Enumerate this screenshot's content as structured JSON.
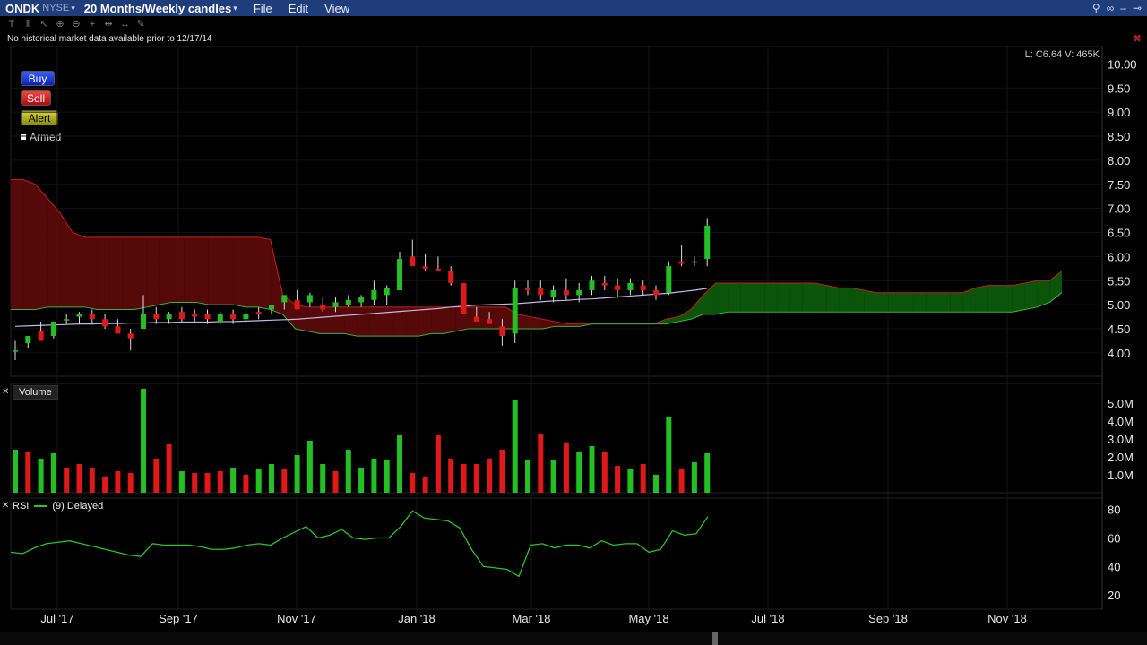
{
  "header": {
    "symbol": "ONDK",
    "exchange": "NYSE",
    "period": "20 Months/Weekly candles",
    "menu": [
      "File",
      "Edit",
      "View"
    ]
  },
  "notice": "No historical market data available prior to 12/17/14",
  "buttons": {
    "buy": "Buy",
    "sell": "Sell",
    "alert": "Alert",
    "armed": "Armed"
  },
  "last_info": "L: C6.64 V: 465K",
  "volume_label": "Volume",
  "rsi_label": {
    "name": "RSI",
    "params": "(9) Delayed"
  },
  "colors": {
    "up": "#22c022",
    "down": "#e01818",
    "cloud_red": "#5a0a0a",
    "cloud_green": "#0c5a0c",
    "titlebar": "#1f3d7a"
  },
  "chart_data": [
    {
      "type": "candlestick",
      "title": "ONDK",
      "ylim": [
        3.7,
        10.1
      ],
      "y_ticks": [
        "10.00",
        "9.50",
        "9.00",
        "8.50",
        "8.00",
        "7.50",
        "7.00",
        "6.50",
        "6.00",
        "5.50",
        "5.00",
        "4.50",
        "4.00"
      ],
      "x_ticks": [
        "Jul '17",
        "Sep '17",
        "Nov '17",
        "Jan '18",
        "Mar '18",
        "May '18",
        "Jul '18",
        "Sep '18",
        "Nov '18"
      ],
      "candles": [
        [
          4.05,
          4.25,
          3.85,
          4.05
        ],
        [
          4.2,
          4.35,
          4.1,
          4.35
        ],
        [
          4.45,
          4.65,
          4.25,
          4.25
        ],
        [
          4.35,
          4.65,
          4.3,
          4.65
        ],
        [
          4.7,
          4.8,
          4.6,
          4.7
        ],
        [
          4.75,
          4.85,
          4.6,
          4.8
        ],
        [
          4.8,
          4.9,
          4.6,
          4.7
        ],
        [
          4.7,
          4.8,
          4.5,
          4.55
        ],
        [
          4.55,
          4.7,
          4.4,
          4.4
        ],
        [
          4.4,
          4.5,
          4.05,
          4.3
        ],
        [
          4.5,
          5.2,
          4.5,
          4.8
        ],
        [
          4.8,
          4.95,
          4.6,
          4.7
        ],
        [
          4.7,
          4.85,
          4.6,
          4.8
        ],
        [
          4.85,
          4.95,
          4.65,
          4.7
        ],
        [
          4.8,
          4.9,
          4.65,
          4.75
        ],
        [
          4.8,
          4.9,
          4.6,
          4.7
        ],
        [
          4.65,
          4.85,
          4.6,
          4.8
        ],
        [
          4.8,
          4.9,
          4.6,
          4.7
        ],
        [
          4.7,
          4.9,
          4.6,
          4.8
        ],
        [
          4.85,
          4.95,
          4.7,
          4.8
        ],
        [
          4.9,
          5.0,
          4.8,
          5.0
        ],
        [
          5.05,
          5.2,
          4.9,
          5.2
        ],
        [
          5.1,
          5.3,
          4.9,
          4.9
        ],
        [
          5.05,
          5.25,
          4.95,
          5.2
        ],
        [
          5.0,
          5.15,
          4.85,
          4.9
        ],
        [
          4.95,
          5.15,
          4.85,
          5.05
        ],
        [
          5.0,
          5.2,
          4.95,
          5.1
        ],
        [
          5.05,
          5.2,
          4.95,
          5.15
        ],
        [
          5.1,
          5.5,
          5.0,
          5.3
        ],
        [
          5.2,
          5.4,
          5.0,
          5.35
        ],
        [
          5.3,
          6.1,
          5.3,
          5.95
        ],
        [
          6.0,
          6.35,
          5.8,
          5.8
        ],
        [
          5.8,
          6.05,
          5.7,
          5.75
        ],
        [
          5.75,
          6.0,
          5.7,
          5.7
        ],
        [
          5.7,
          5.8,
          5.4,
          5.45
        ],
        [
          5.45,
          5.45,
          4.8,
          4.8
        ],
        [
          4.75,
          4.95,
          4.65,
          4.65
        ],
        [
          4.7,
          4.85,
          4.6,
          4.6
        ],
        [
          4.55,
          4.7,
          4.15,
          4.35
        ],
        [
          4.4,
          5.5,
          4.2,
          5.35
        ],
        [
          5.35,
          5.5,
          5.2,
          5.3
        ],
        [
          5.35,
          5.5,
          5.1,
          5.2
        ],
        [
          5.15,
          5.4,
          5.05,
          5.3
        ],
        [
          5.3,
          5.55,
          5.1,
          5.2
        ],
        [
          5.2,
          5.45,
          5.05,
          5.3
        ],
        [
          5.3,
          5.6,
          5.2,
          5.5
        ],
        [
          5.45,
          5.6,
          5.3,
          5.4
        ],
        [
          5.4,
          5.55,
          5.15,
          5.3
        ],
        [
          5.3,
          5.55,
          5.2,
          5.45
        ],
        [
          5.4,
          5.5,
          5.2,
          5.3
        ],
        [
          5.3,
          5.4,
          5.1,
          5.2
        ],
        [
          5.25,
          5.9,
          5.2,
          5.8
        ],
        [
          5.9,
          6.25,
          5.8,
          5.85
        ],
        [
          5.9,
          6.0,
          5.8,
          5.9
        ],
        [
          5.95,
          6.8,
          5.8,
          6.64
        ]
      ],
      "overlay_line": {
        "name": "moving-average",
        "values": [
          4.55,
          4.56,
          4.57,
          4.58,
          4.59,
          4.6,
          4.6,
          4.61,
          4.61,
          4.62,
          4.62,
          4.63,
          4.63,
          4.64,
          4.64,
          4.64,
          4.65,
          4.65,
          4.66,
          4.67,
          4.68,
          4.69,
          4.7,
          4.72,
          4.74,
          4.76,
          4.78,
          4.8,
          4.82,
          4.84,
          4.86,
          4.88,
          4.9,
          4.92,
          4.95,
          4.97,
          4.99,
          5.0,
          5.01,
          5.02,
          5.04,
          5.06,
          5.08,
          5.09,
          5.11,
          5.12,
          5.14,
          5.16,
          5.18,
          5.2,
          5.22,
          5.24,
          5.27,
          5.3,
          5.34
        ]
      },
      "cloud": {
        "upper": [
          7.6,
          7.6,
          7.5,
          7.2,
          6.9,
          6.5,
          6.4,
          6.4,
          6.4,
          6.4,
          6.4,
          6.4,
          6.4,
          6.4,
          6.4,
          6.4,
          6.4,
          6.4,
          6.4,
          6.4,
          6.4,
          6.35,
          5.2,
          5.0,
          4.95,
          4.95,
          4.95,
          4.95,
          4.95,
          4.95,
          4.95,
          4.95,
          4.95,
          4.95,
          4.95,
          4.95,
          4.95,
          4.95,
          4.95,
          4.95,
          4.95,
          4.8,
          4.75,
          4.7,
          4.65,
          4.6,
          4.6,
          4.6,
          4.6,
          4.6,
          4.6,
          4.6,
          4.6,
          4.7,
          4.75,
          4.9,
          5.2,
          5.45,
          5.45,
          5.45,
          5.45,
          5.45,
          5.45,
          5.45,
          5.45,
          5.45,
          5.4,
          5.35,
          5.35,
          5.3,
          5.25,
          5.25,
          5.25,
          5.25,
          5.25,
          5.25,
          5.25,
          5.25,
          5.35,
          5.4,
          5.4,
          5.4,
          5.45,
          5.5,
          5.5,
          5.7
        ],
        "lower": [
          4.9,
          4.9,
          4.9,
          4.95,
          4.95,
          4.95,
          4.95,
          4.9,
          4.9,
          4.9,
          4.9,
          4.95,
          5.0,
          5.05,
          5.05,
          5.05,
          5.0,
          5.0,
          5.0,
          4.95,
          4.95,
          4.9,
          4.8,
          4.5,
          4.45,
          4.4,
          4.4,
          4.4,
          4.35,
          4.35,
          4.35,
          4.35,
          4.35,
          4.35,
          4.4,
          4.4,
          4.45,
          4.5,
          4.5,
          4.5,
          4.5,
          4.5,
          4.5,
          4.5,
          4.55,
          4.55,
          4.55,
          4.6,
          4.6,
          4.6,
          4.6,
          4.6,
          4.6,
          4.6,
          4.65,
          4.7,
          4.8,
          4.8,
          4.85,
          4.85,
          4.85,
          4.85,
          4.85,
          4.85,
          4.85,
          4.85,
          4.85,
          4.85,
          4.85,
          4.85,
          4.85,
          4.85,
          4.85,
          4.85,
          4.85,
          4.85,
          4.85,
          4.85,
          4.85,
          4.85,
          4.85,
          4.85,
          4.9,
          4.95,
          5.05,
          5.25
        ]
      }
    },
    {
      "type": "bar",
      "title": "Volume",
      "ylim": [
        0,
        5800000
      ],
      "y_ticks": [
        "5.0M",
        "4.0M",
        "3.0M",
        "2.0M",
        "1.0M"
      ],
      "values": [
        2.4,
        2.3,
        1.9,
        2.2,
        1.4,
        1.6,
        1.4,
        0.9,
        1.2,
        1.1,
        5.8,
        1.9,
        2.7,
        1.2,
        1.1,
        1.1,
        1.2,
        1.4,
        1.0,
        1.3,
        1.6,
        1.3,
        2.1,
        2.9,
        1.6,
        1.2,
        2.4,
        1.4,
        1.9,
        1.8,
        3.2,
        1.1,
        0.9,
        3.2,
        1.9,
        1.6,
        1.6,
        1.9,
        2.4,
        5.2,
        1.8,
        3.3,
        1.8,
        2.8,
        2.3,
        2.6,
        2.3,
        1.5,
        1.3,
        1.6,
        1.0,
        4.2,
        1.3,
        1.7,
        2.2
      ],
      "up": [
        true,
        false,
        true,
        true,
        false,
        false,
        false,
        false,
        false,
        false,
        true,
        false,
        false,
        true,
        false,
        false,
        false,
        true,
        false,
        true,
        true,
        false,
        true,
        true,
        true,
        false,
        true,
        true,
        true,
        true,
        true,
        false,
        false,
        false,
        false,
        false,
        false,
        false,
        false,
        true,
        true,
        false,
        true,
        false,
        true,
        true,
        false,
        false,
        true,
        false,
        true,
        true,
        false,
        true,
        true
      ]
    },
    {
      "type": "line",
      "title": "RSI",
      "ylim": [
        10,
        88
      ],
      "y_ticks": [
        "80",
        "60",
        "40",
        "20"
      ],
      "values": [
        50,
        49,
        53,
        56,
        57,
        58,
        56,
        54,
        52,
        50,
        48,
        47,
        56,
        55,
        55,
        55,
        54,
        52,
        52,
        53,
        55,
        56,
        55,
        60,
        64,
        68,
        60,
        62,
        66,
        60,
        59,
        60,
        60,
        68,
        79,
        74,
        73,
        72,
        67,
        52,
        40,
        39,
        38,
        33,
        55,
        56,
        53,
        55,
        55,
        53,
        58,
        55,
        56,
        56,
        50,
        52,
        65,
        62,
        63,
        75
      ]
    }
  ]
}
